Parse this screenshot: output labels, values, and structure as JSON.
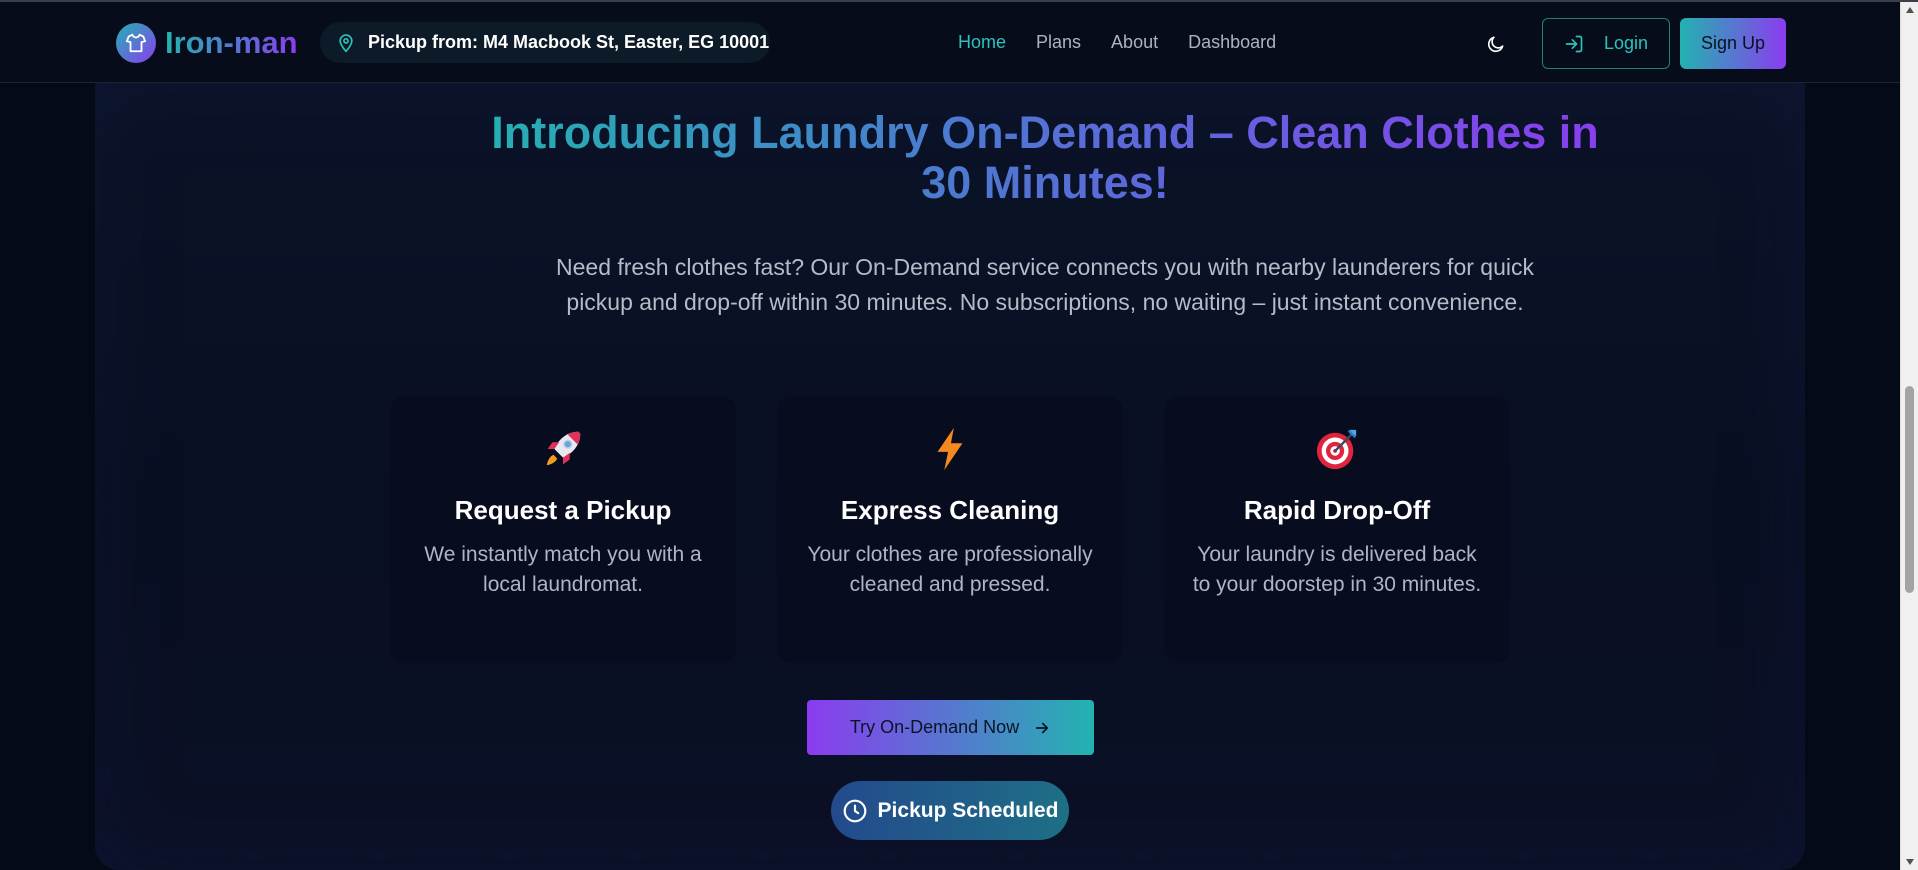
{
  "header": {
    "brand_name": "Iron-man",
    "brand_icon": "shirt-icon",
    "pickup_label": "Pickup from: M4 Macbook St, Easter, EG 10001",
    "nav": [
      {
        "label": "Home",
        "active": true
      },
      {
        "label": "Plans",
        "active": false
      },
      {
        "label": "About",
        "active": false
      },
      {
        "label": "Dashboard",
        "active": false
      }
    ],
    "theme_icon": "moon-icon",
    "login_label": "Login",
    "signup_label": "Sign Up"
  },
  "hero": {
    "title": "Introducing Laundry On-Demand – Clean Clothes in 30 Minutes!",
    "description": "Need fresh clothes fast? Our On-Demand service connects you with nearby launderers for quick pickup and drop-off within 30 minutes. No subscriptions, no waiting – just instant convenience."
  },
  "features": [
    {
      "icon": "rocket-icon",
      "title": "Request a Pickup",
      "description": "We instantly match you with a local laundromat."
    },
    {
      "icon": "lightning-icon",
      "title": "Express Cleaning",
      "description": "Your clothes are professionally cleaned and pressed."
    },
    {
      "icon": "target-icon",
      "title": "Rapid Drop-Off",
      "description": "Your laundry is delivered back to your doorstep in 30 minutes."
    }
  ],
  "cta_label": "Try On-Demand Now",
  "status_label": "Pickup Scheduled",
  "colors": {
    "accent_teal": "#22b3b0",
    "accent_purple": "#8b3cf0",
    "background": "#050a18"
  }
}
